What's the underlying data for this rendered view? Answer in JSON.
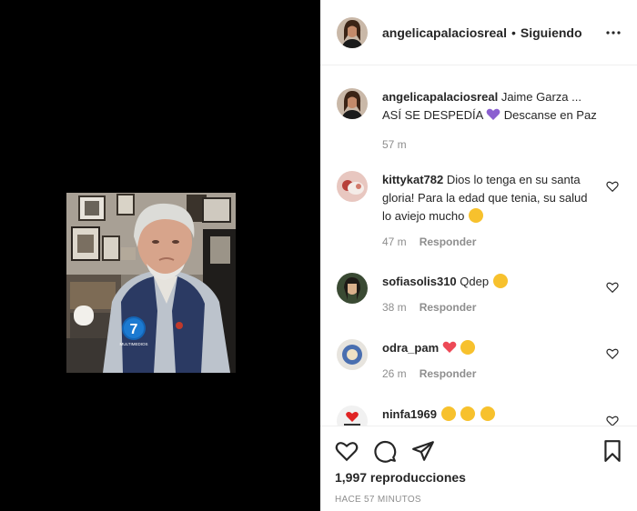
{
  "post": {
    "author": "angelicapalaciosreal",
    "separator": "•",
    "follow_status": "Siguiendo",
    "caption_text": "Jaime Garza ...",
    "caption_text_2": "ASÍ SE DESPEDÍA",
    "caption_text_3": "Descanse en Paz",
    "caption_time": "57 m"
  },
  "video": {
    "logo_text": "7",
    "logo_caption": "MULTIMEDIOS"
  },
  "comments": [
    {
      "user": "kittykat782",
      "text": "Dios lo tenga en su santa gloria! Para la edad que tenia, su salud lo aviejo mucho",
      "time": "47 m",
      "reply": "Responder"
    },
    {
      "user": "sofiasolis310",
      "text": "Qdep",
      "time": "38 m",
      "reply": "Responder"
    },
    {
      "user": "odra_pam",
      "text": "",
      "time": "26 m",
      "reply": "Responder"
    },
    {
      "user": "ninfa1969",
      "text": ""
    }
  ],
  "stats": {
    "views": "1,997 reproducciones",
    "posted": "HACE 57 MINUTOS"
  },
  "colors": {
    "text": "#262626",
    "muted": "#8e8e8e",
    "heart_red": "#ed4956",
    "purple_heart": "#8b5fd0",
    "emoji_yellow": "#f7c12d"
  }
}
